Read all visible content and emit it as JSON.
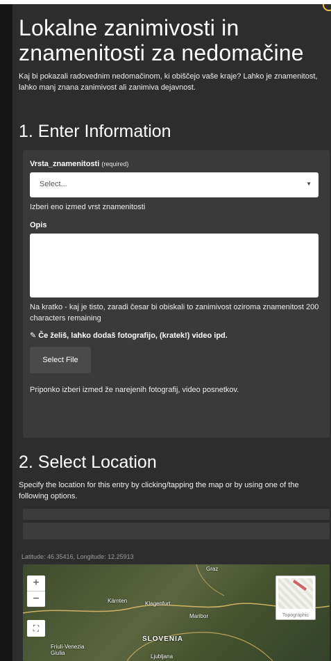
{
  "header": {
    "title": "Lokalne zanimivosti in znamenitosti za nedomačine",
    "intro": "Kaj bi pokazali radovednim nedomačinom, ki obiščejo vaše kraje? Lahko je znamenitost, lahko manj znana zanimivost ali zanimiva dejavnost."
  },
  "section1": {
    "title": "1. Enter Information",
    "type_field": {
      "label": "Vrsta_znamenitosti",
      "required_label": "(required)",
      "selected": "Select...",
      "help": "Izberi eno izmed vrst znamenitosti"
    },
    "description_field": {
      "label": "Opis",
      "value": "",
      "help": "Na kratko - kaj je tisto, zaradi česar bi obiskali to zanimivost oziroma znamenitost 200 characters remaining"
    },
    "attachment": {
      "icon": "paperclip-icon",
      "label": "Če želiš, lahko dodaš fotografijo, (kratek!) video ipd.",
      "button_label": "Select File",
      "note": "Priponko izberi izmed že narejenih fotografij, video posnetkov."
    }
  },
  "section2": {
    "title": "2. Select Location",
    "description": "Specify the location for this entry by clicking/tapping the map or by using one of the following options.",
    "coords": "Latitude: 46.35416,  Longitude: 12.25913"
  },
  "map": {
    "zoom_in": "+",
    "zoom_out": "−",
    "fullscreen": "⛶",
    "basemap_label": "Topographic",
    "labels": {
      "graz": "Graz",
      "karnten": "Kärnten",
      "klagenfurt": "Klagenfurt",
      "maribor": "Maribor",
      "slovenia": "SLOVENIA",
      "friuli": "Friuli-Venezia Giulia",
      "ljubljana": "Ljubljana"
    }
  },
  "colors": {
    "page_bg": "#2d2d2d",
    "panel_bg": "#3a3a3a",
    "accent_badge": "#f1c233"
  }
}
